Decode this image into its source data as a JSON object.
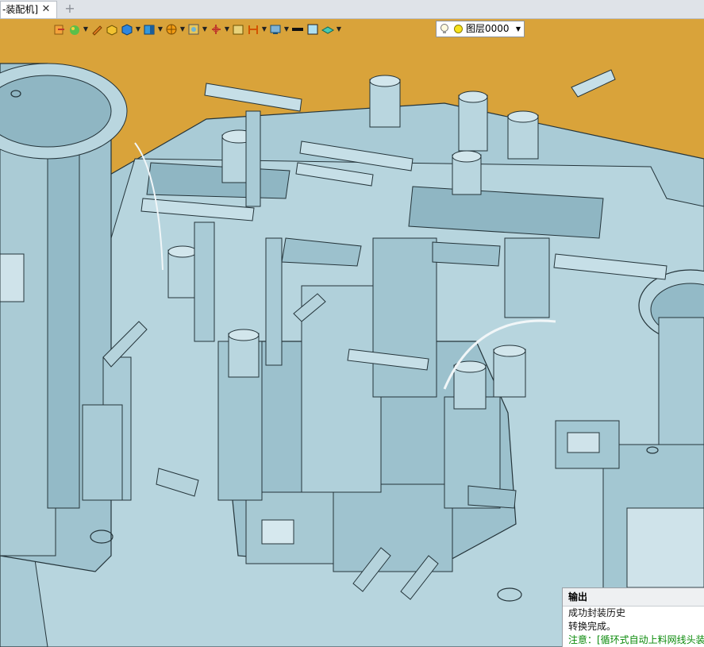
{
  "tab": {
    "title": "-装配机]",
    "close": "✕",
    "add": "+"
  },
  "toolbar": {
    "tools": [
      "import-icon",
      "palette-icon",
      "pen-icon",
      "solid-yellow-icon",
      "box-icon",
      "box-blue-icon",
      "sphere-orange-icon",
      "view-icon",
      "axis-icon",
      "frame-icon",
      "dimension-icon",
      "display-icon",
      "black-line-icon",
      "blue-fill-icon",
      "layer-stack-icon"
    ],
    "layer": {
      "label": "图层0000",
      "dropdown": "▼"
    }
  },
  "output": {
    "title": "输出",
    "lines": [
      "成功封装历史",
      "转换完成。"
    ],
    "note": "注意：[循环式自动上料网线头装"
  },
  "colors": {
    "background": "#d9a33a",
    "model": "#a7c9d3",
    "model_dark": "#7ea8b5",
    "edge": "#24343a"
  }
}
